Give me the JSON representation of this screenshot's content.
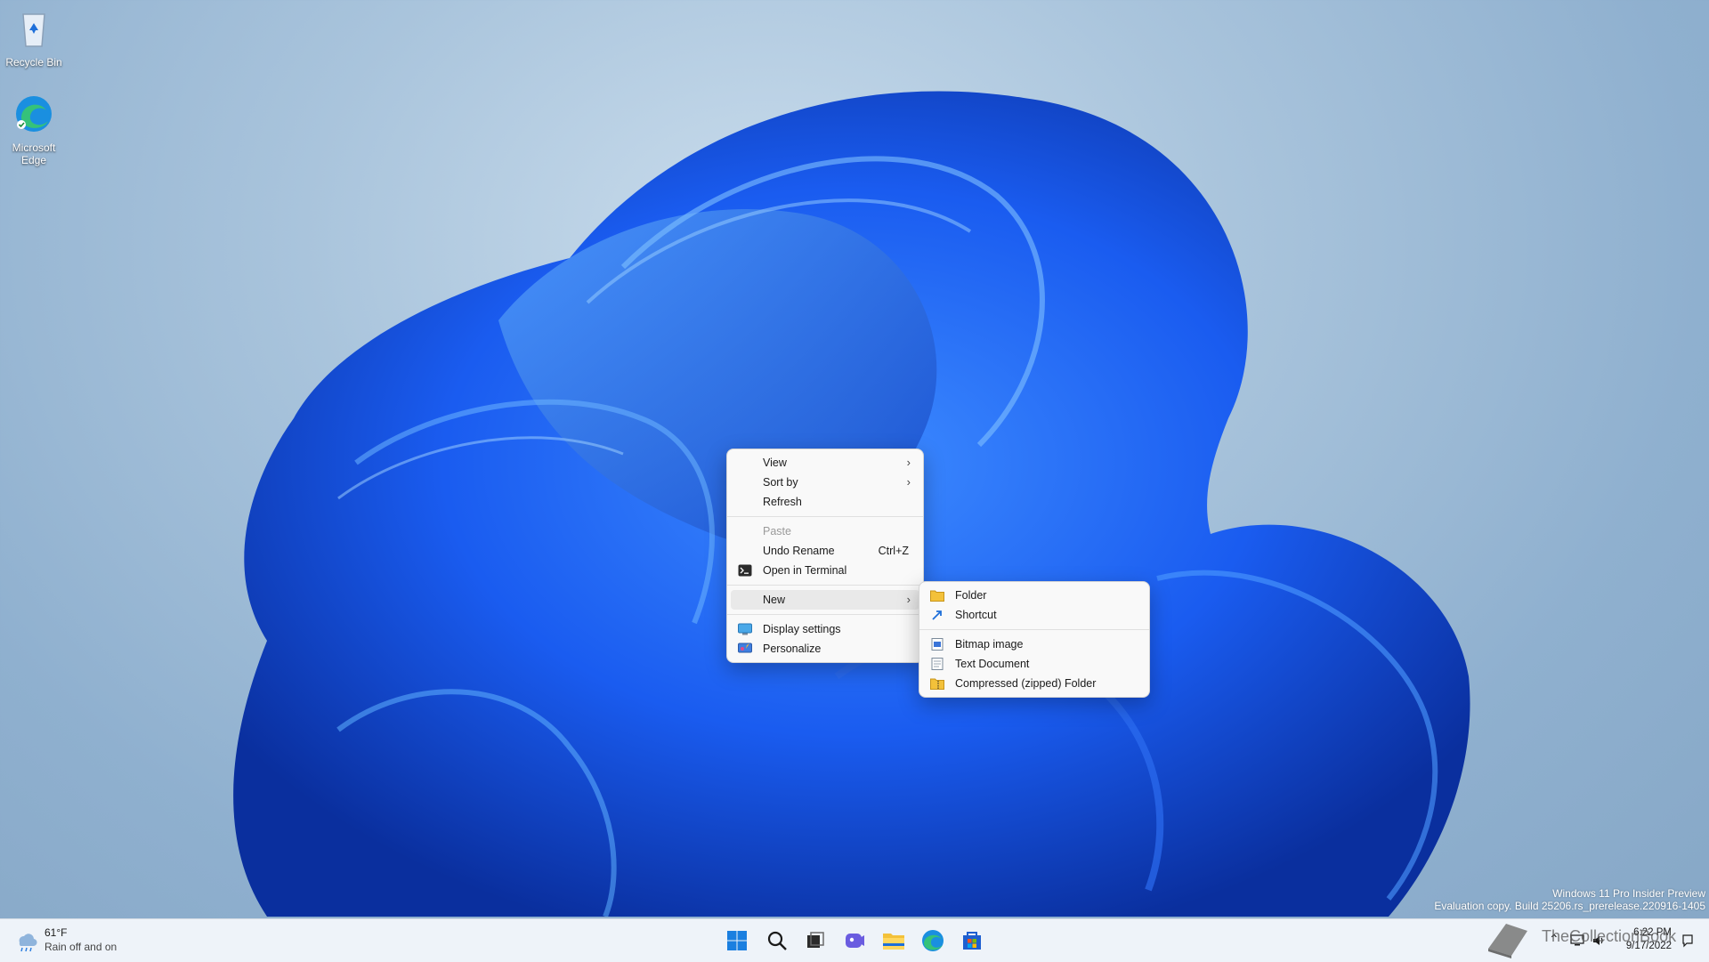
{
  "desktop": {
    "icons": [
      {
        "label": "Recycle Bin"
      },
      {
        "label": "Microsoft Edge"
      }
    ],
    "watermark": {
      "line1": "Windows 11 Pro Insider Preview",
      "line2": "Evaluation copy. Build 25206.rs_prerelease.220916-1405"
    }
  },
  "context_menu": {
    "items": [
      {
        "label": "View",
        "has_submenu": true
      },
      {
        "label": "Sort by",
        "has_submenu": true
      },
      {
        "label": "Refresh"
      },
      {
        "label": "Paste",
        "disabled": true
      },
      {
        "label": "Undo Rename",
        "accelerator": "Ctrl+Z"
      },
      {
        "label": "Open in Terminal",
        "icon": "terminal-icon"
      },
      {
        "label": "New",
        "has_submenu": true,
        "highlighted": true
      },
      {
        "label": "Display settings",
        "icon": "display-icon"
      },
      {
        "label": "Personalize",
        "icon": "personalize-icon"
      }
    ]
  },
  "new_submenu": {
    "items": [
      {
        "label": "Folder",
        "icon": "folder-icon"
      },
      {
        "label": "Shortcut",
        "icon": "shortcut-icon"
      },
      {
        "label": "Bitmap image",
        "icon": "bitmap-icon"
      },
      {
        "label": "Text Document",
        "icon": "text-document-icon"
      },
      {
        "label": "Compressed (zipped) Folder",
        "icon": "zip-folder-icon"
      }
    ]
  },
  "taskbar": {
    "weather": {
      "temp": "61°F",
      "condition": "Rain off and on"
    },
    "apps": [
      "start-icon",
      "search-icon",
      "task-view-icon",
      "chat-icon",
      "file-explorer-icon",
      "edge-icon",
      "store-icon"
    ],
    "clock": {
      "time": "6:22 PM",
      "date": "9/17/2022"
    }
  },
  "overlay": {
    "brand": "TheCollectionBook"
  },
  "colors": {
    "accent": "#0067c0",
    "menu_bg": "#f9f9f9",
    "taskbar_bg": "#eef3f9"
  }
}
